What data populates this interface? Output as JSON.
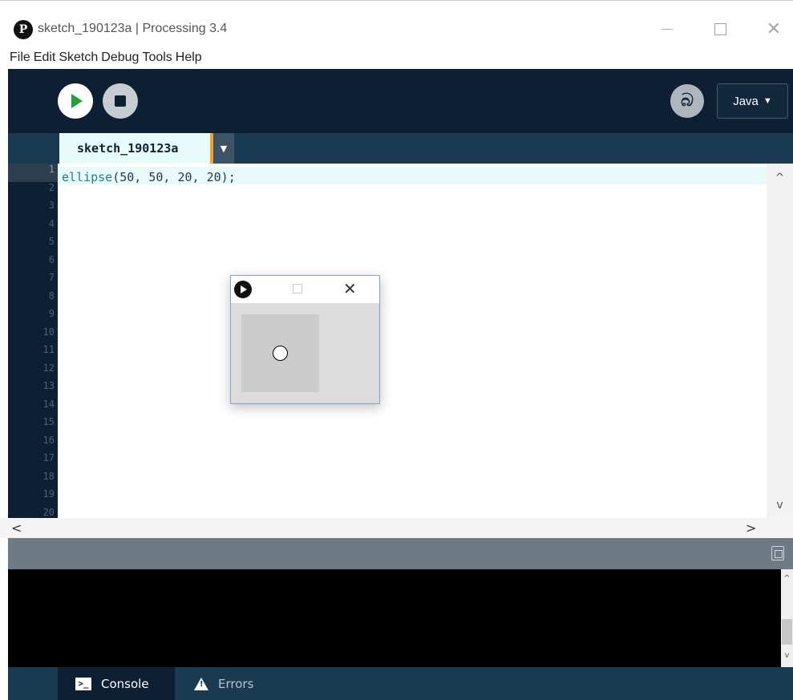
{
  "window": {
    "title": "sketch_190123a | Processing 3.4",
    "close_glyph": "✕"
  },
  "menu": [
    "File",
    "Edit",
    "Sketch",
    "Debug",
    "Tools",
    "Help"
  ],
  "toolbar": {
    "debug_glyph": "බ",
    "mode_label": "Java",
    "mode_arrow": "▼"
  },
  "tabs": {
    "active_label": "sketch_190123a",
    "menu_arrow": "▼"
  },
  "editor": {
    "line_numbers": [
      "1",
      "2",
      "3",
      "4",
      "5",
      "6",
      "7",
      "8",
      "9",
      "10",
      "11",
      "12",
      "13",
      "14",
      "15",
      "16",
      "17",
      "18",
      "19",
      "20"
    ],
    "code_fn": "ellipse",
    "code_args": "(50, 50, 20, 20);",
    "scroll_up": "^",
    "scroll_down": "v",
    "scroll_left": "<",
    "scroll_right": ">"
  },
  "console": {
    "scroll_up": "^",
    "scroll_down": "v"
  },
  "footer": {
    "console_label": "Console",
    "console_icon_text": ">_",
    "errors_label": "Errors"
  },
  "sketch_window": {
    "close_glyph": "✕"
  },
  "colors": {
    "toolbar_bg": "#0d2033",
    "tab_active_bg": "#e6fbfa",
    "tab_accent": "#f7a12b",
    "run_green": "#21a33c",
    "status_bar": "#6e7a84"
  },
  "icons": [
    "processing-logo-icon",
    "run-icon",
    "stop-icon",
    "debug-icon",
    "copy-icon",
    "console-icon",
    "warning-icon"
  ]
}
